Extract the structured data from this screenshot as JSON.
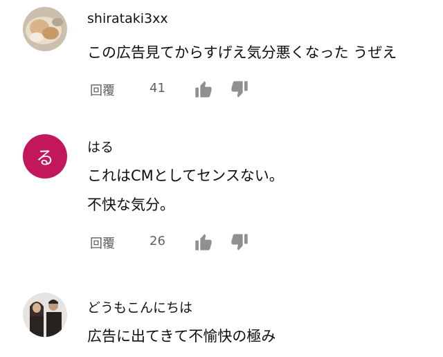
{
  "comments": [
    {
      "author": "shirataki3xx",
      "avatar_letter": "",
      "lines": [
        "この広告見てからすげえ気分悪くなった うぜえ"
      ],
      "reply_label": "回覆",
      "likes": "41"
    },
    {
      "author": "はる",
      "avatar_letter": "る",
      "avatar_color": "#c2185b",
      "lines": [
        "これはCMとしてセンスない。",
        "不快な気分。"
      ],
      "reply_label": "回覆",
      "likes": "26"
    },
    {
      "author": "どうもこんにちは",
      "avatar_letter": "",
      "lines": [
        "広告に出てきて不愉快の極み"
      ]
    }
  ],
  "icons": {
    "like": "thumb-up-icon",
    "dislike": "thumb-down-icon"
  }
}
